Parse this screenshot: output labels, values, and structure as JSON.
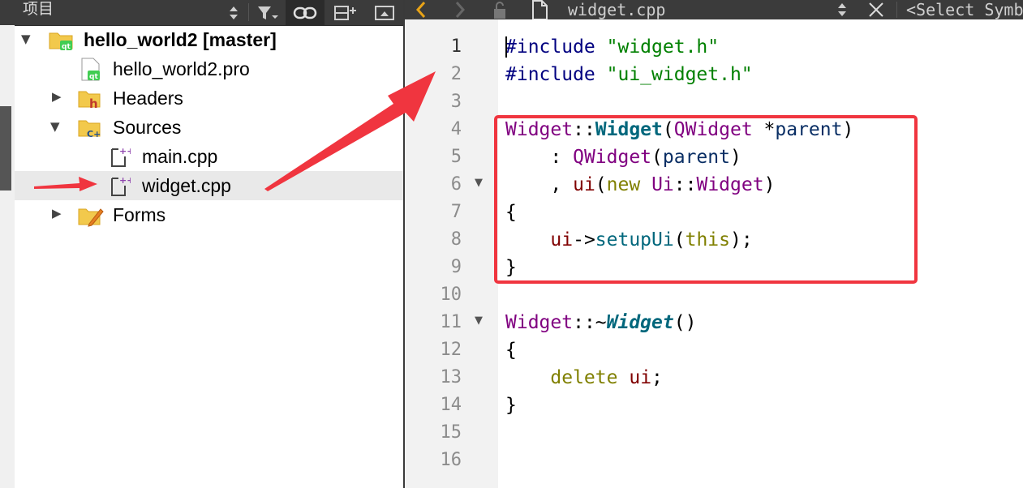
{
  "project_panel": {
    "title": "项目",
    "tree": [
      {
        "label": "hello_world2 [master]",
        "type": "project",
        "expanded": true,
        "icon": "qt-project-folder-icon"
      },
      {
        "label": "hello_world2.pro",
        "type": "file",
        "icon": "qt-pro-file-icon"
      },
      {
        "label": "Headers",
        "type": "folder",
        "expanded": false,
        "icon": "headers-folder-icon"
      },
      {
        "label": "Sources",
        "type": "folder",
        "expanded": true,
        "icon": "sources-folder-icon"
      },
      {
        "label": "main.cpp",
        "type": "file",
        "icon": "cpp-file-icon"
      },
      {
        "label": "widget.cpp",
        "type": "file",
        "selected": true,
        "icon": "cpp-file-icon"
      },
      {
        "label": "Forms",
        "type": "folder",
        "expanded": false,
        "icon": "forms-folder-icon"
      }
    ]
  },
  "editor": {
    "file_name": "widget.cpp",
    "symbol_selector": "<Select Symb",
    "current_line": 1,
    "line_numbers": [
      "1",
      "2",
      "3",
      "4",
      "5",
      "6",
      "7",
      "8",
      "9",
      "10",
      "11",
      "12",
      "13",
      "14",
      "15",
      "16"
    ],
    "fold_markers_at_lines": [
      6,
      11
    ],
    "code": {
      "l1_directive": "#include",
      "l1_file": "\"widget.h\"",
      "l2_directive": "#include",
      "l2_file": "\"ui_widget.h\"",
      "l4_class": "Widget",
      "l4_scope": "::",
      "l4_ctor": "Widget",
      "l4_open": "(",
      "l4_ptype": "QWidget",
      "l4_star": " *",
      "l4_param": "parent",
      "l4_close": ")",
      "l5_colon": "    : ",
      "l5_base": "QWidget",
      "l5_open": "(",
      "l5_arg": "parent",
      "l5_close": ")",
      "l6_comma": "    , ",
      "l6_member": "ui",
      "l6_open": "(",
      "l6_new": "new",
      "l6_space": " ",
      "l6_ns": "Ui",
      "l6_scope": "::",
      "l6_cls": "Widget",
      "l6_close": ")",
      "l7": "{",
      "l8_indent": "    ",
      "l8_member": "ui",
      "l8_arrow": "->",
      "l8_call": "setupUi",
      "l8_open": "(",
      "l8_this": "this",
      "l8_close": ");",
      "l9": "}",
      "l11_class": "Widget",
      "l11_scope": "::~",
      "l11_dtor": "Widget",
      "l11_parens": "()",
      "l12": "{",
      "l13_indent": "    ",
      "l13_kw": "delete",
      "l13_space": " ",
      "l13_member": "ui",
      "l13_semi": ";",
      "l14": "}"
    }
  },
  "annotations": {
    "highlight_color": "#f0353f",
    "arrow_color": "#f0353f"
  }
}
